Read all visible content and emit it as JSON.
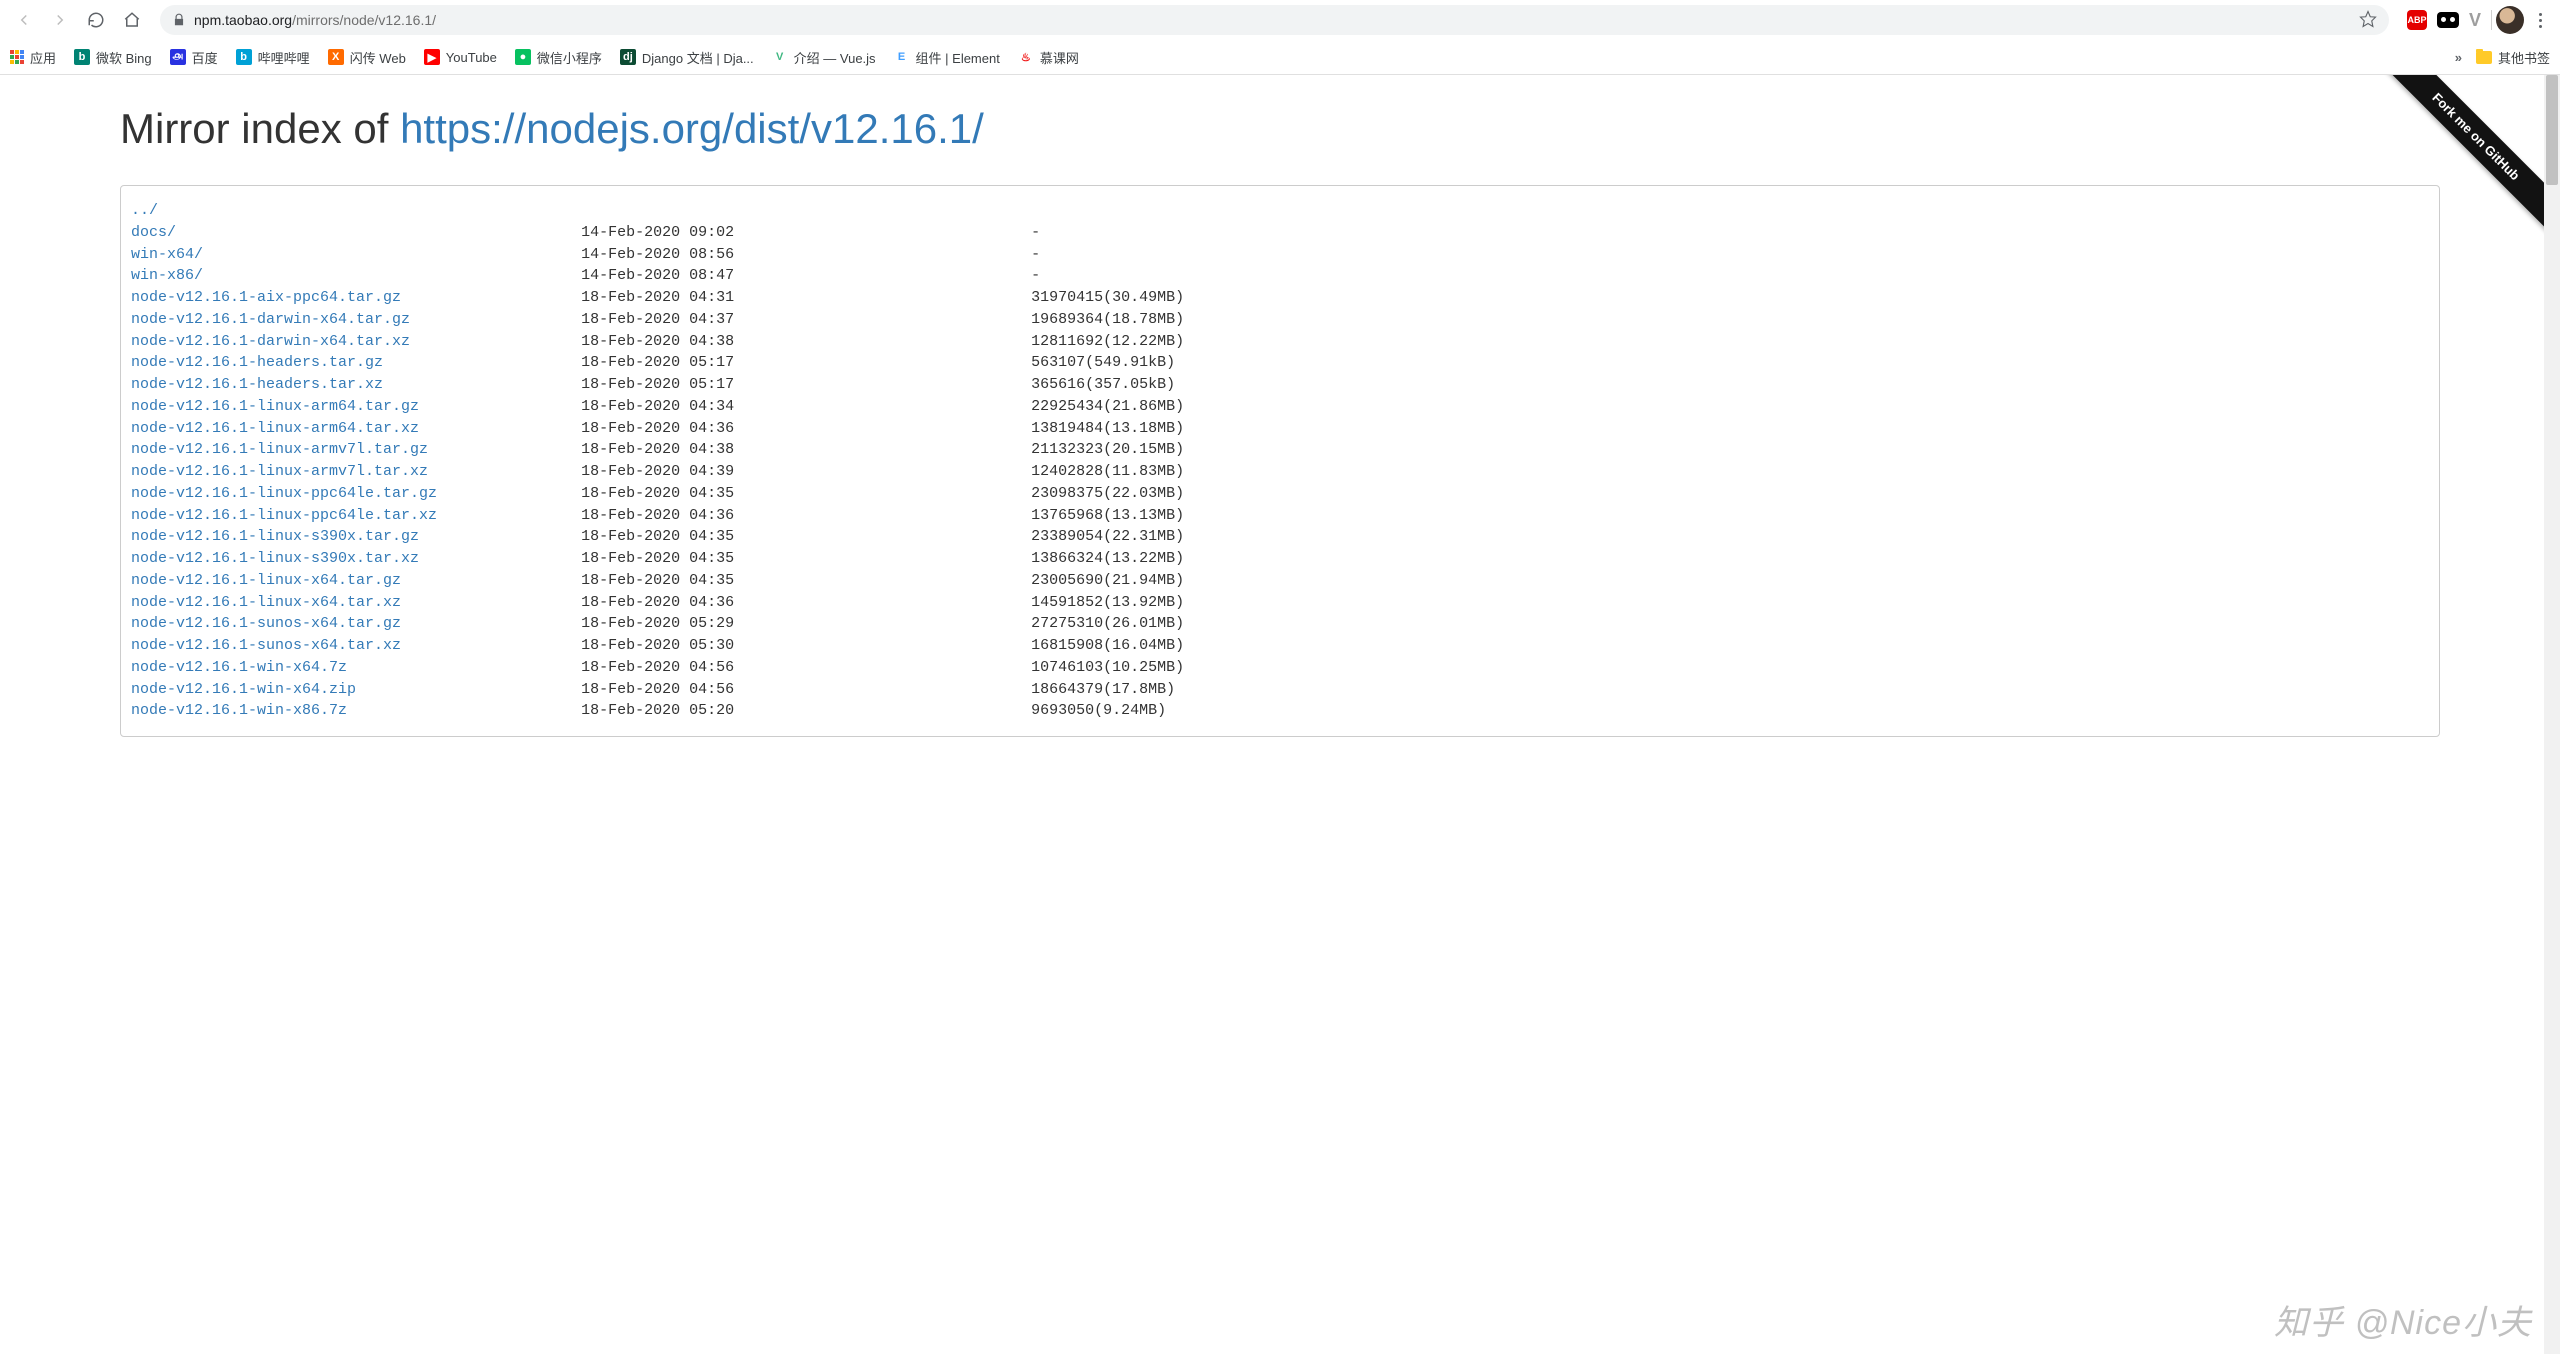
{
  "browser": {
    "url_host": "npm.taobao.org",
    "url_path": "/mirrors/node/v12.16.1/",
    "abp_label": "ABP"
  },
  "bookmarks": {
    "apps": "应用",
    "items": [
      {
        "label": "微软 Bing",
        "icon_bg": "#008373",
        "icon_txt": "b"
      },
      {
        "label": "百度",
        "icon_bg": "#2932e1",
        "icon_txt": "௮"
      },
      {
        "label": "哔哩哔哩",
        "icon_bg": "#00a1d6",
        "icon_txt": "b"
      },
      {
        "label": "闪传 Web",
        "icon_bg": "#ff6a00",
        "icon_txt": "X"
      },
      {
        "label": "YouTube",
        "icon_bg": "#ff0000",
        "icon_txt": "▶"
      },
      {
        "label": "微信小程序",
        "icon_bg": "#07c160",
        "icon_txt": "●"
      },
      {
        "label": "Django 文档 | Dja...",
        "icon_bg": "#0c4b33",
        "icon_txt": "dj"
      },
      {
        "label": "介绍 — Vue.js",
        "icon_bg": "#ffffff",
        "icon_txt": "V",
        "icon_fg": "#41b883"
      },
      {
        "label": "组件 | Element",
        "icon_bg": "#ffffff",
        "icon_txt": "E",
        "icon_fg": "#409eff"
      },
      {
        "label": "慕课网",
        "icon_bg": "#ffffff",
        "icon_txt": "♨",
        "icon_fg": "#f01414"
      }
    ],
    "overflow": "»",
    "other": "其他书签"
  },
  "ribbon": "Fork me on GitHub",
  "heading_prefix": "Mirror index of ",
  "heading_link": "https://nodejs.org/dist/v12.16.1/",
  "listing": [
    {
      "name": "../",
      "date": "",
      "size": ""
    },
    {
      "name": "docs/",
      "date": "14-Feb-2020 09:02",
      "size": "-"
    },
    {
      "name": "win-x64/",
      "date": "14-Feb-2020 08:56",
      "size": "-"
    },
    {
      "name": "win-x86/",
      "date": "14-Feb-2020 08:47",
      "size": "-"
    },
    {
      "name": "node-v12.16.1-aix-ppc64.tar.gz",
      "date": "18-Feb-2020 04:31",
      "size": "31970415(30.49MB)"
    },
    {
      "name": "node-v12.16.1-darwin-x64.tar.gz",
      "date": "18-Feb-2020 04:37",
      "size": "19689364(18.78MB)"
    },
    {
      "name": "node-v12.16.1-darwin-x64.tar.xz",
      "date": "18-Feb-2020 04:38",
      "size": "12811692(12.22MB)"
    },
    {
      "name": "node-v12.16.1-headers.tar.gz",
      "date": "18-Feb-2020 05:17",
      "size": "563107(549.91kB)"
    },
    {
      "name": "node-v12.16.1-headers.tar.xz",
      "date": "18-Feb-2020 05:17",
      "size": "365616(357.05kB)"
    },
    {
      "name": "node-v12.16.1-linux-arm64.tar.gz",
      "date": "18-Feb-2020 04:34",
      "size": "22925434(21.86MB)"
    },
    {
      "name": "node-v12.16.1-linux-arm64.tar.xz",
      "date": "18-Feb-2020 04:36",
      "size": "13819484(13.18MB)"
    },
    {
      "name": "node-v12.16.1-linux-armv7l.tar.gz",
      "date": "18-Feb-2020 04:38",
      "size": "21132323(20.15MB)"
    },
    {
      "name": "node-v12.16.1-linux-armv7l.tar.xz",
      "date": "18-Feb-2020 04:39",
      "size": "12402828(11.83MB)"
    },
    {
      "name": "node-v12.16.1-linux-ppc64le.tar.gz",
      "date": "18-Feb-2020 04:35",
      "size": "23098375(22.03MB)"
    },
    {
      "name": "node-v12.16.1-linux-ppc64le.tar.xz",
      "date": "18-Feb-2020 04:36",
      "size": "13765968(13.13MB)"
    },
    {
      "name": "node-v12.16.1-linux-s390x.tar.gz",
      "date": "18-Feb-2020 04:35",
      "size": "23389054(22.31MB)"
    },
    {
      "name": "node-v12.16.1-linux-s390x.tar.xz",
      "date": "18-Feb-2020 04:35",
      "size": "13866324(13.22MB)"
    },
    {
      "name": "node-v12.16.1-linux-x64.tar.gz",
      "date": "18-Feb-2020 04:35",
      "size": "23005690(21.94MB)"
    },
    {
      "name": "node-v12.16.1-linux-x64.tar.xz",
      "date": "18-Feb-2020 04:36",
      "size": "14591852(13.92MB)"
    },
    {
      "name": "node-v12.16.1-sunos-x64.tar.gz",
      "date": "18-Feb-2020 05:29",
      "size": "27275310(26.01MB)"
    },
    {
      "name": "node-v12.16.1-sunos-x64.tar.xz",
      "date": "18-Feb-2020 05:30",
      "size": "16815908(16.04MB)"
    },
    {
      "name": "node-v12.16.1-win-x64.7z",
      "date": "18-Feb-2020 04:56",
      "size": "10746103(10.25MB)"
    },
    {
      "name": "node-v12.16.1-win-x64.zip",
      "date": "18-Feb-2020 04:56",
      "size": "18664379(17.8MB)"
    },
    {
      "name": "node-v12.16.1-win-x86.7z",
      "date": "18-Feb-2020 05:20",
      "size": "9693050(9.24MB)"
    }
  ],
  "columns": {
    "name_width": 50,
    "date_width": 50
  },
  "watermark": "知乎 @Nice小夫"
}
